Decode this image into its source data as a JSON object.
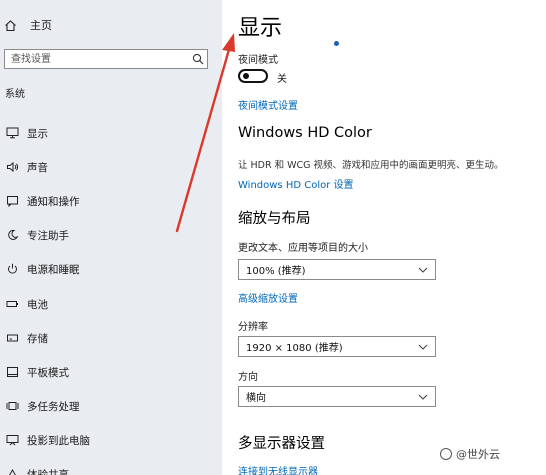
{
  "sidebar": {
    "home_label": "主页",
    "search_placeholder": "查找设置",
    "section_label": "系统",
    "items": [
      {
        "label": "显示",
        "icon": "monitor-icon"
      },
      {
        "label": "声音",
        "icon": "speaker-icon"
      },
      {
        "label": "通知和操作",
        "icon": "notification-icon"
      },
      {
        "label": "专注助手",
        "icon": "moon-icon"
      },
      {
        "label": "电源和睡眠",
        "icon": "power-icon"
      },
      {
        "label": "电池",
        "icon": "battery-icon"
      },
      {
        "label": "存储",
        "icon": "storage-icon"
      },
      {
        "label": "平板模式",
        "icon": "tablet-icon"
      },
      {
        "label": "多任务处理",
        "icon": "multitask-icon"
      },
      {
        "label": "投影到此电脑",
        "icon": "project-icon"
      },
      {
        "label": "体验共享",
        "icon": "share-icon"
      }
    ]
  },
  "main": {
    "title": "显示",
    "night_light": {
      "label": "夜间模式",
      "state": "关",
      "settings_link": "夜间模式设置"
    },
    "hd_color": {
      "heading": "Windows HD Color",
      "description": "让 HDR 和 WCG 视频、游戏和应用中的画面更明亮、更生动。",
      "link": "Windows HD Color 设置"
    },
    "scale_layout": {
      "heading": "缩放与布局",
      "size_label": "更改文本、应用等项目的大小",
      "size_value": "100% (推荐)",
      "advanced_link": "高级缩放设置",
      "resolution_label": "分辨率",
      "resolution_value": "1920 × 1080 (推荐)",
      "orientation_label": "方向",
      "orientation_value": "横向"
    },
    "multi_display": {
      "heading": "多显示器设置",
      "wireless_link": "连接到无线显示器"
    }
  },
  "watermark": "@世外云",
  "colors": {
    "sidebar_bg": "#e9ecf0",
    "link": "#0067b8",
    "annotation_arrow": "#d93a2b"
  }
}
